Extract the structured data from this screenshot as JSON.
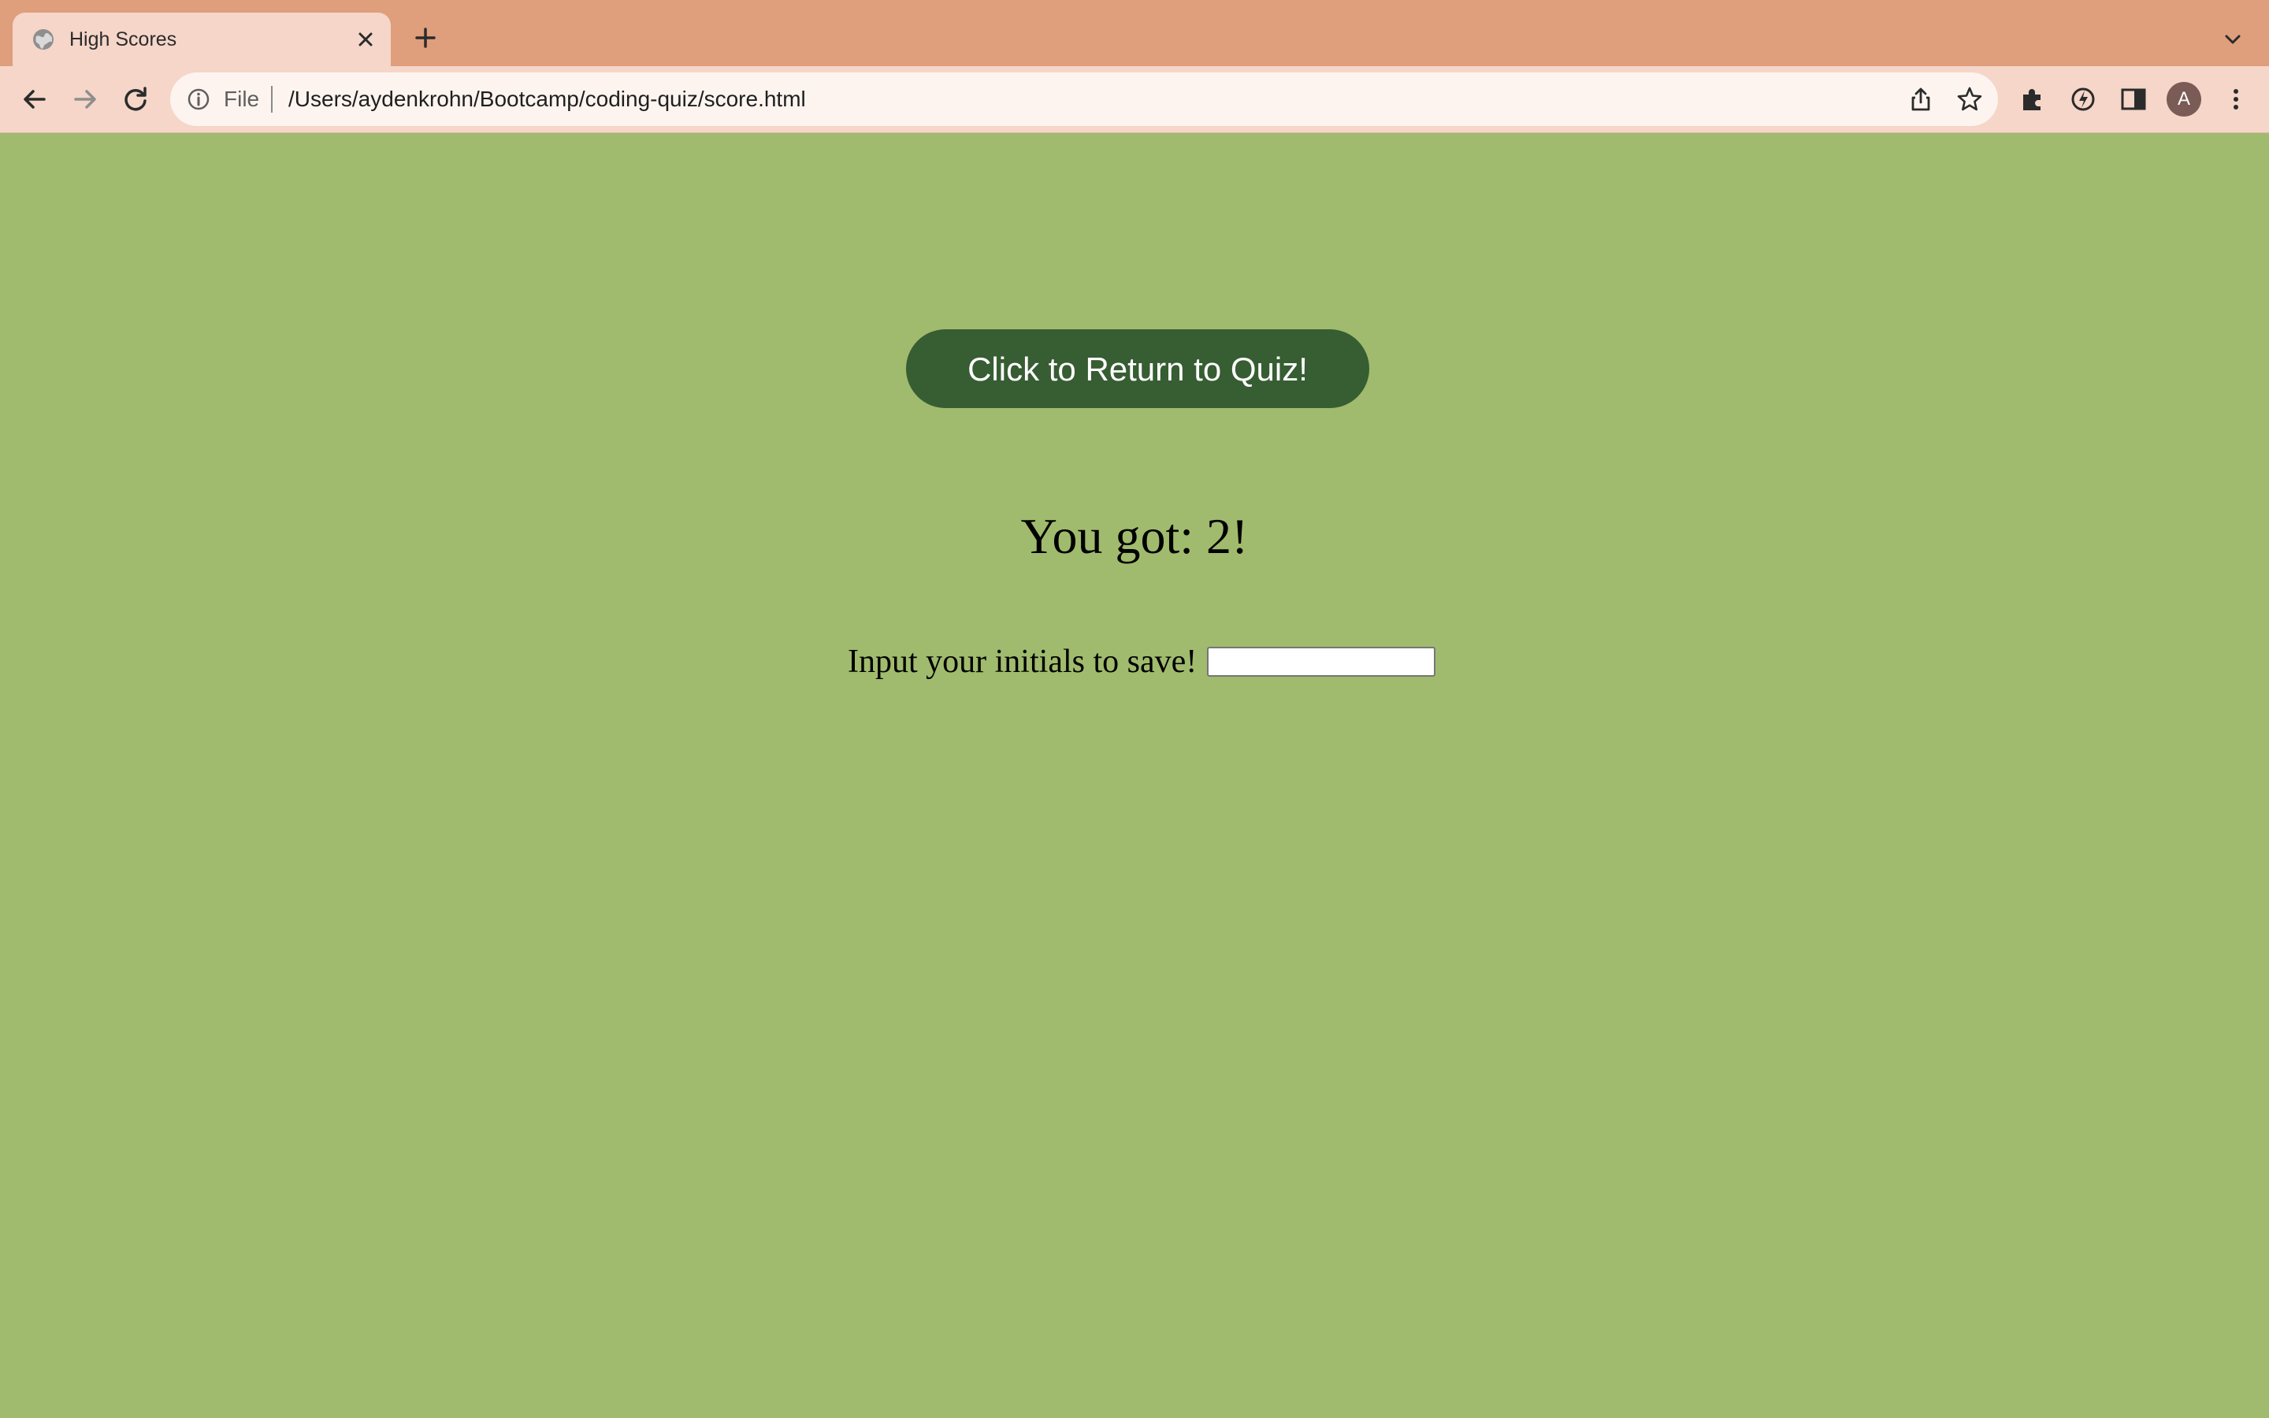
{
  "browser": {
    "tab": {
      "title": "High Scores",
      "favicon": "globe-icon"
    },
    "omnibox": {
      "scheme_label": "File",
      "url": "/Users/aydenkrohn/Bootcamp/coding-quiz/score.html"
    },
    "profile": {
      "initial": "A"
    },
    "colors": {
      "tabstrip": "#df9e7c",
      "toolbar": "#f5d6c9",
      "omnibox": "#fdf4ef"
    }
  },
  "page": {
    "background_color": "#a0bb6d",
    "return_button_label": "Click to Return to Quiz!",
    "return_button_color": "#375d32",
    "score_text": "You got: 2!",
    "save_label": "Input your initials to save!",
    "initials_value": ""
  }
}
